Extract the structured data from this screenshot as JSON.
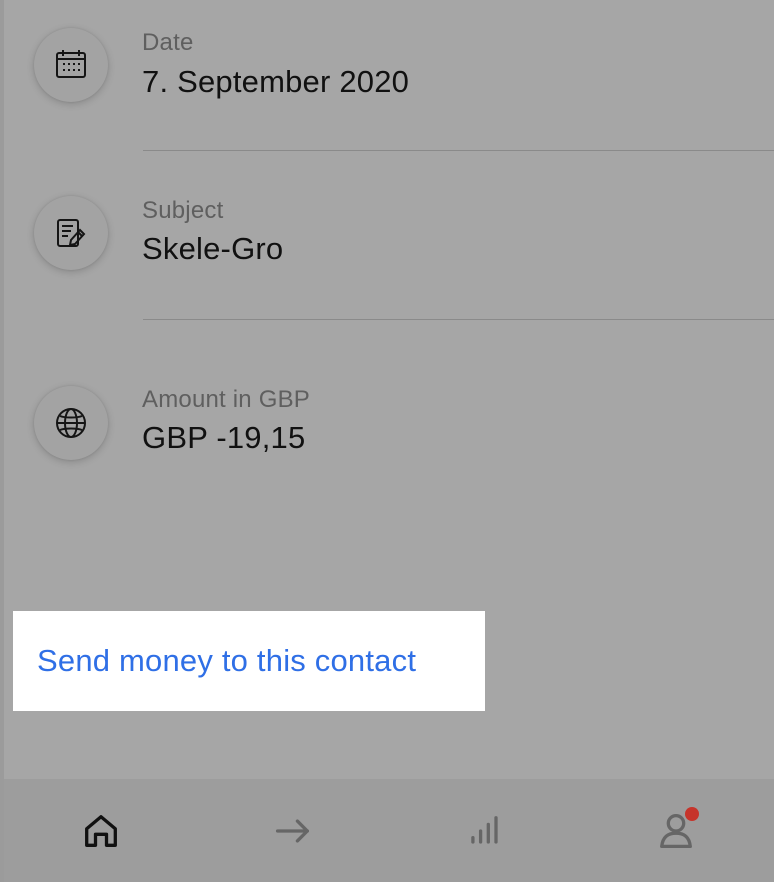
{
  "details": [
    {
      "label": "Date",
      "value": "7. September 2020",
      "icon": "calendar-icon"
    },
    {
      "label": "Subject",
      "value": "Skele-Gro",
      "icon": "edit-note-icon"
    },
    {
      "label": "Amount in GBP",
      "value": "GBP -19,15",
      "icon": "globe-icon"
    }
  ],
  "cta": {
    "label": "Send money to this contact",
    "color": "#2f6fe6"
  },
  "bottom_nav": [
    {
      "name": "home",
      "icon": "home-icon",
      "active": true
    },
    {
      "name": "transfer",
      "icon": "arrow-right-icon",
      "active": false
    },
    {
      "name": "stats",
      "icon": "bar-chart-icon",
      "active": false
    },
    {
      "name": "profile",
      "icon": "profile-icon",
      "active": false,
      "badge": true
    }
  ],
  "colors": {
    "overlay_background": "#a6a6a6",
    "notification_badge": "#c6342b",
    "active_nav_icon": "#111111",
    "inactive_nav_icon": "#666666"
  }
}
